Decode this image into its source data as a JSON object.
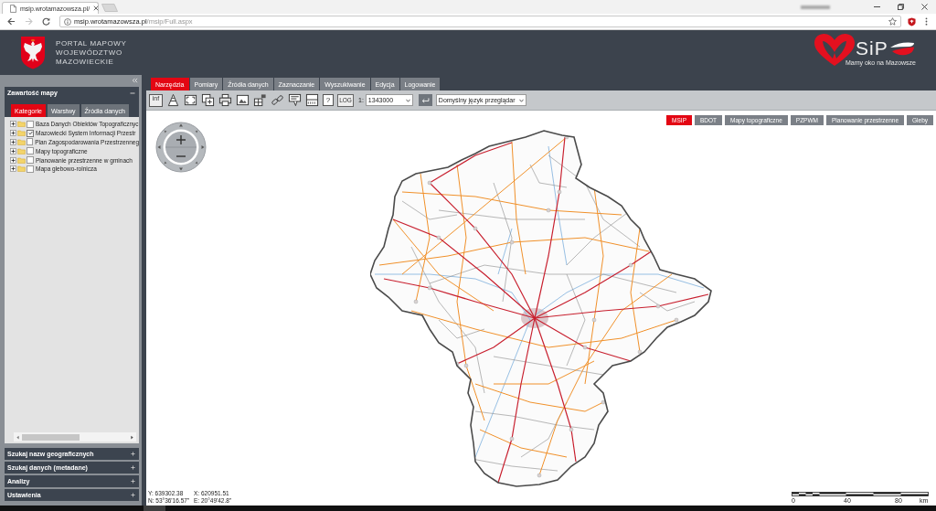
{
  "browser": {
    "tab": {
      "title": "msip.wrotamazowsza.pl/"
    },
    "nav": {
      "back_disabled": false,
      "forward_disabled": true
    },
    "url": {
      "host": "msip.wrotamazowsza.pl",
      "path": "/msip/Full.aspx"
    }
  },
  "header": {
    "portal_title": [
      "PORTAL MAPOWY",
      "WOJEWÓDZTWO",
      "MAZOWIECKIE"
    ],
    "logo_text": "SiP",
    "logo_tagline": "Mamy oko na Mazowsze"
  },
  "sidebar": {
    "panel_title": "Zawartość mapy",
    "tabs": [
      {
        "label": "Kategorie",
        "selected": true
      },
      {
        "label": "Warstwy",
        "selected": false
      },
      {
        "label": "Źródła danych",
        "selected": false
      }
    ],
    "tree": [
      {
        "label": "Baza Danych Obiektów Topograficznyc",
        "checked": false
      },
      {
        "label": "Mazowiecki System Informacji Przestr",
        "checked": true
      },
      {
        "label": "Plan Zagospodarowania Przestrzenneg",
        "checked": false
      },
      {
        "label": "Mapy topograficzne",
        "checked": false
      },
      {
        "label": "Planowanie przestrzenne w gminach",
        "checked": false
      },
      {
        "label": "Mapa glebowo-rolnicza",
        "checked": false
      }
    ],
    "sections": [
      {
        "label": "Szukaj nazw geograficznych"
      },
      {
        "label": "Szukaj danych (metadane)"
      },
      {
        "label": "Analizy"
      },
      {
        "label": "Ustawienia"
      }
    ]
  },
  "main": {
    "tabs": [
      {
        "label": "Narzędzia",
        "selected": true
      },
      {
        "label": "Pomiary",
        "selected": false
      },
      {
        "label": "Źródła danych",
        "selected": false
      },
      {
        "label": "Zaznaczanie",
        "selected": false
      },
      {
        "label": "Wyszukiwanie",
        "selected": false
      },
      {
        "label": "Edycja",
        "selected": false
      },
      {
        "label": "Logowanie",
        "selected": false
      }
    ],
    "toolbar": {
      "info_label": "inf",
      "help_label": "?",
      "log_label": "LOG",
      "scale_prefix": "1:",
      "scale": "1343000",
      "language": "Domyślny język przeglądar"
    },
    "layers": [
      {
        "label": "MSIP",
        "selected": true
      },
      {
        "label": "BDOT",
        "selected": false
      },
      {
        "label": "Mapy topograficzne",
        "selected": false
      },
      {
        "label": "PZPWM",
        "selected": false
      },
      {
        "label": "Planowanie przestrzenne",
        "selected": false
      },
      {
        "label": "Gleby",
        "selected": false
      }
    ],
    "coordinates": [
      "Y: 639302.38",
      "X: 620951.51",
      "N: 53°36'16.57\"",
      "E: 20°49'42.8\""
    ],
    "scale_bar": {
      "labels": [
        "0",
        "40",
        "80"
      ],
      "unit": "km"
    }
  }
}
